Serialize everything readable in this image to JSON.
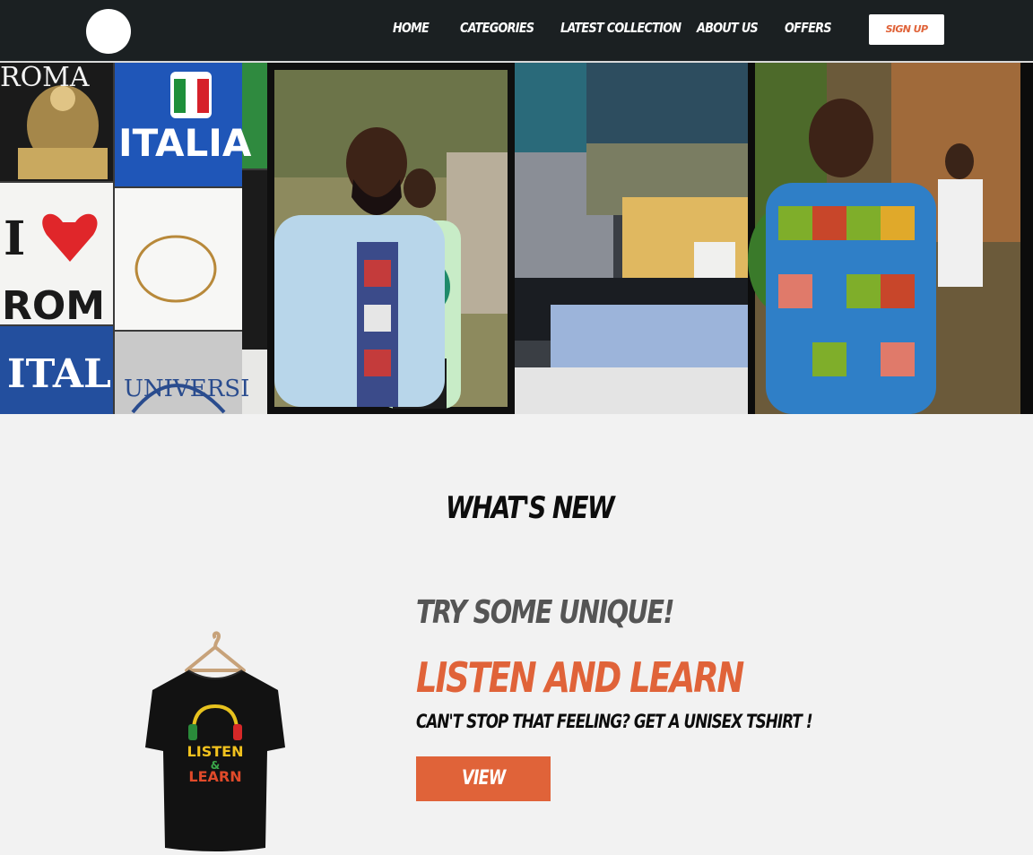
{
  "nav": {
    "links": [
      "Home",
      "Categories",
      "Latest Collection",
      "About Us",
      "Offers"
    ],
    "signup_label": "Sign Up"
  },
  "hero": {
    "panels": [
      {
        "icon": "souvenir-tshirts-photo",
        "texts": [
          "ROMA",
          "ITALIA",
          "I",
          "ROM",
          "ITAL",
          "UNIVERSI"
        ]
      },
      {
        "icon": "man-light-blue-shirt-photo"
      },
      {
        "icon": "folded-clothes-photo"
      },
      {
        "icon": "man-african-print-shirt-photo"
      }
    ]
  },
  "whats_new": {
    "heading": "What's New",
    "tagline": "Try Some Unique!",
    "product_title": "Listen and Learn",
    "product_description": "Can't stop that feeling? Get a unisex tshirt !",
    "view_label": "View",
    "tshirt_print": [
      "LISTEN",
      "&",
      "LEARN"
    ]
  },
  "colors": {
    "navbar_bg": "#1b2022",
    "accent": "#e06339",
    "page_bg": "#f2f2f2",
    "text_dark": "#0d0d0d",
    "text_gray": "#555555"
  }
}
